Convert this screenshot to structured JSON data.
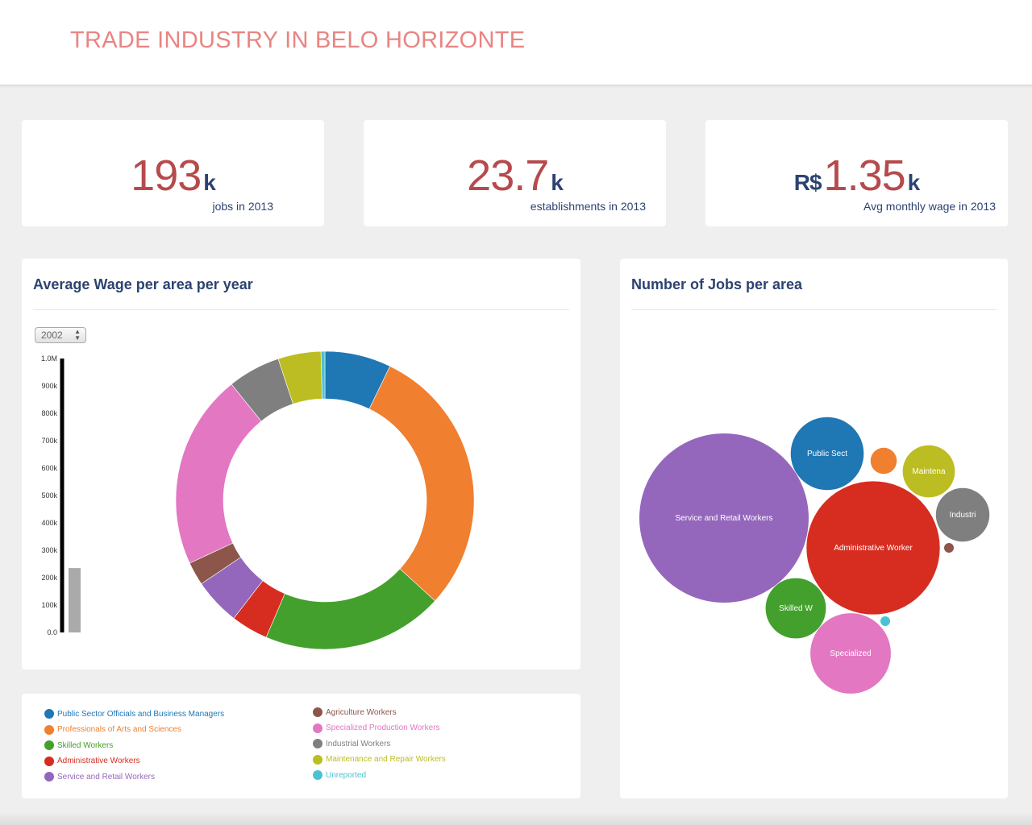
{
  "header": {
    "title": "TRADE INDUSTRY IN BELO HORIZONTE"
  },
  "kpis": [
    {
      "value": "193",
      "unit": "k",
      "prefix": "",
      "label": "jobs in 2013"
    },
    {
      "value": "23.7",
      "unit": "k",
      "prefix": "",
      "label": "establishments in 2013"
    },
    {
      "value": "1.35",
      "unit": "k",
      "prefix": "R$",
      "label": "Avg monthly wage in 2013"
    }
  ],
  "wage_panel": {
    "title": "Average Wage per area per year",
    "year_select": {
      "value": "2002"
    }
  },
  "jobs_panel": {
    "title": "Number of Jobs per area"
  },
  "legend": [
    {
      "label": "Public Sector Officials and Business Managers",
      "color": "#1f77b4"
    },
    {
      "label": "Professionals of Arts and Sciences",
      "color": "#f07f2f"
    },
    {
      "label": "Skilled Workers",
      "color": "#44a02c"
    },
    {
      "label": "Administrative Workers",
      "color": "#d62d20"
    },
    {
      "label": "Service and Retail Workers",
      "color": "#9467bd"
    },
    {
      "label": "Agriculture Workers",
      "color": "#8c564b"
    },
    {
      "label": "Specialized Production Workers",
      "color": "#e377c2"
    },
    {
      "label": "Industrial Workers",
      "color": "#7f7f7f"
    },
    {
      "label": "Maintenance and Repair Workers",
      "color": "#bcbd22"
    },
    {
      "label": "Unreported",
      "color": "#4bc2d3"
    }
  ],
  "chart_data": [
    {
      "type": "bar",
      "title": "",
      "categories": [
        "2002"
      ],
      "values": [
        235000
      ],
      "ylim": [
        0,
        1000000
      ],
      "ticks": [
        "0.0",
        "100k",
        "200k",
        "300k",
        "400k",
        "500k",
        "600k",
        "700k",
        "800k",
        "900k",
        "1.0M"
      ]
    },
    {
      "type": "pie",
      "donut": true,
      "slices": [
        {
          "label": "Public Sector Officials and Business Managers",
          "value": 6.8,
          "color": "#1f77b4"
        },
        {
          "label": "Professionals of Arts and Sciences",
          "value": 28.0,
          "color": "#f07f2f"
        },
        {
          "label": "Skilled Workers",
          "value": 18.6,
          "color": "#44a02c"
        },
        {
          "label": "Administrative Workers",
          "value": 3.8,
          "color": "#d62d20"
        },
        {
          "label": "Service and Retail Workers",
          "value": 4.8,
          "color": "#9467bd"
        },
        {
          "label": "Agriculture Workers",
          "value": 2.4,
          "color": "#8c564b"
        },
        {
          "label": "Specialized Production Workers",
          "value": 20.0,
          "color": "#e377c2"
        },
        {
          "label": "Industrial Workers",
          "value": 5.4,
          "color": "#7f7f7f"
        },
        {
          "label": "Maintenance and Repair Workers",
          "value": 4.4,
          "color": "#bcbd22"
        },
        {
          "label": "Unreported",
          "value": 0.4,
          "color": "#4bc2d3"
        }
      ]
    },
    {
      "type": "bubble",
      "bubbles": [
        {
          "label": "Service and Retail Workers",
          "value": 100,
          "color": "#9467bd"
        },
        {
          "label": "Administrative Worker",
          "value": 62,
          "color": "#d62d20"
        },
        {
          "label": "Public Sect",
          "value": 18.6,
          "color": "#1f77b4"
        },
        {
          "label": "Specialized",
          "value": 22.6,
          "color": "#e377c2"
        },
        {
          "label": "Skilled W",
          "value": 12.7,
          "color": "#44a02c"
        },
        {
          "label": "Maintena",
          "value": 9.5,
          "color": "#bcbd22"
        },
        {
          "label": "Industri",
          "value": 10,
          "color": "#7f7f7f"
        },
        {
          "label": "",
          "value": 2.4,
          "color": "#f07f2f"
        },
        {
          "label": "",
          "value": 0.2,
          "color": "#8c564b"
        },
        {
          "label": "",
          "value": 0.15,
          "color": "#4bc2d3"
        }
      ]
    }
  ]
}
